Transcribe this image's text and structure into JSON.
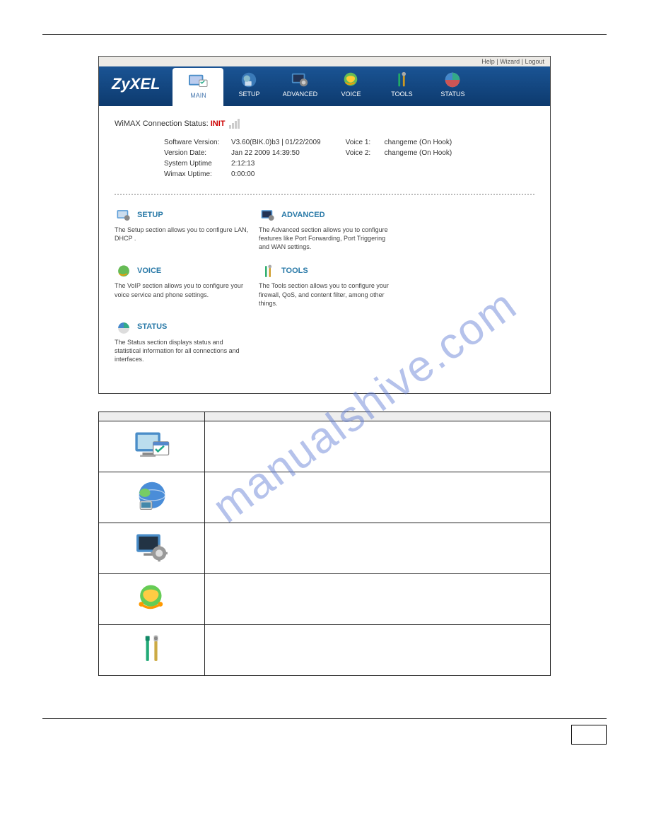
{
  "topbar": {
    "help": "Help",
    "wizard": "Wizard",
    "logout": "Logout"
  },
  "logo": {
    "brand": "ZyXEL",
    "sub": ""
  },
  "nav": {
    "main": "MAIN",
    "setup": "SETUP",
    "advanced": "ADVANCED",
    "voice": "VOICE",
    "tools": "TOOLS",
    "status": "STATUS"
  },
  "status_line": {
    "prefix": "WiMAX Connection Status: ",
    "value": "INIT"
  },
  "info_left": [
    {
      "label": "Software Version:",
      "value": "V3.60(BIK.0)b3 | 01/22/2009"
    },
    {
      "label": "Version Date:",
      "value": "Jan 22 2009 14:39:50"
    },
    {
      "label": "System Uptime",
      "value": "2:12:13"
    },
    {
      "label": "Wimax Uptime:",
      "value": "0:00:00"
    }
  ],
  "info_right": [
    {
      "label": "Voice 1:",
      "value": "changeme (On Hook)"
    },
    {
      "label": "Voice 2:",
      "value": "changeme (On Hook)"
    }
  ],
  "cards": {
    "setup": {
      "title": "SETUP",
      "desc": "The Setup section allows you to configure LAN, DHCP ."
    },
    "advanced": {
      "title": "ADVANCED",
      "desc": "The Advanced section allows you to configure features like Port Forwarding, Port Triggering and WAN settings."
    },
    "voice": {
      "title": "VOICE",
      "desc": "The VoIP section allows you to configure your voice service and phone settings."
    },
    "tools": {
      "title": "TOOLS",
      "desc": "The Tools section allows you to configure your firewall, QoS, and content filter, among other things."
    },
    "status": {
      "title": "STATUS",
      "desc": "The Status section displays status and statistical information for all connections and interfaces."
    }
  },
  "watermark": "manualshive.com"
}
